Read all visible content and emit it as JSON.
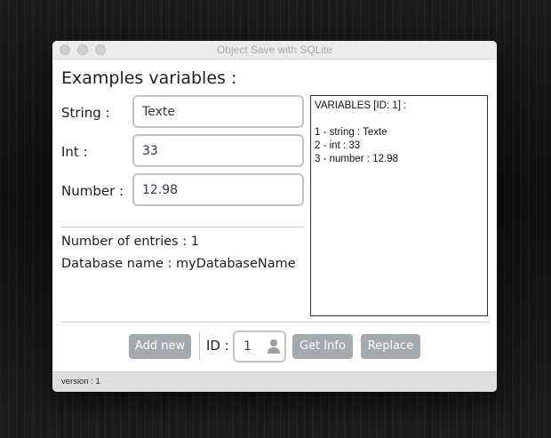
{
  "window": {
    "title": "Object Save with SQLite"
  },
  "form": {
    "heading": "Examples variables :",
    "fields": [
      {
        "label": "String :",
        "value": "Texte"
      },
      {
        "label": "Int :",
        "value": "33"
      },
      {
        "label": "Number :",
        "value": "12.98"
      }
    ]
  },
  "info": {
    "entries": "Number of entries : 1",
    "database": "Database name : myDatabaseName"
  },
  "output": {
    "header": "VARIABLES [ID: 1] :",
    "lines": [
      "1 - string : Texte",
      "2 - int : 33",
      "3 - number : 12.98"
    ]
  },
  "toolbar": {
    "add_label": "Add new",
    "id_label": "ID :",
    "id_value": "1",
    "get_info_label": "Get Info",
    "replace_label": "Replace"
  },
  "status": {
    "version": "version : 1"
  },
  "icons": {
    "id_icon": "user-icon"
  },
  "colors": {
    "button_bg": "#a4a9af",
    "input_text": "#2f3a4a",
    "input_border": "#c4c4c4"
  }
}
